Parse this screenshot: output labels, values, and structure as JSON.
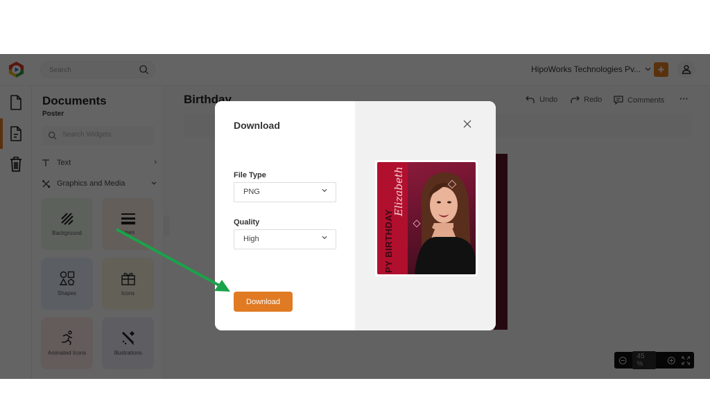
{
  "app": {
    "search_placeholder": "Search",
    "org_name": "HipoWorks Technologies Pv...",
    "colors": {
      "accent": "#e07a23",
      "annotation_arrow": "#1aa34a",
      "poster_red": "#b0102e"
    }
  },
  "rail": {
    "items": [
      {
        "icon": "document-icon"
      },
      {
        "icon": "document-text-icon",
        "active": true
      },
      {
        "icon": "trash-icon"
      }
    ]
  },
  "panel": {
    "title": "Documents",
    "subtitle": "Poster",
    "search_placeholder": "Search Widgets",
    "categories": [
      {
        "label": "Text",
        "icon": "text-icon",
        "chevron": "›"
      },
      {
        "label": "Graphics and Media",
        "icon": "graphics-icon",
        "chevron": "⌄"
      }
    ],
    "tiles": [
      {
        "label": "Background",
        "icon": "background-icon"
      },
      {
        "label": "Lines",
        "icon": "lines-icon"
      },
      {
        "label": "Shapes",
        "icon": "shapes-icon"
      },
      {
        "label": "Icons",
        "icon": "gift-icon"
      },
      {
        "label": "Animated Icons",
        "icon": "running-icon"
      },
      {
        "label": "Illustrations",
        "icon": "illustration-icon"
      }
    ]
  },
  "editor": {
    "doc_title": "Birthday",
    "toolbar": {
      "undo": "Undo",
      "redo": "Redo",
      "comments": "Comments",
      "more": "···"
    },
    "zoom": {
      "value": "45",
      "unit": "%"
    }
  },
  "modal": {
    "title": "Download",
    "file_type_label": "File Type",
    "file_type_value": "PNG",
    "quality_label": "Quality",
    "quality_value": "High",
    "download_button": "Download",
    "preview": {
      "name_text": "Elizabeth",
      "banner_text": "PY BIRTHDAY"
    }
  }
}
